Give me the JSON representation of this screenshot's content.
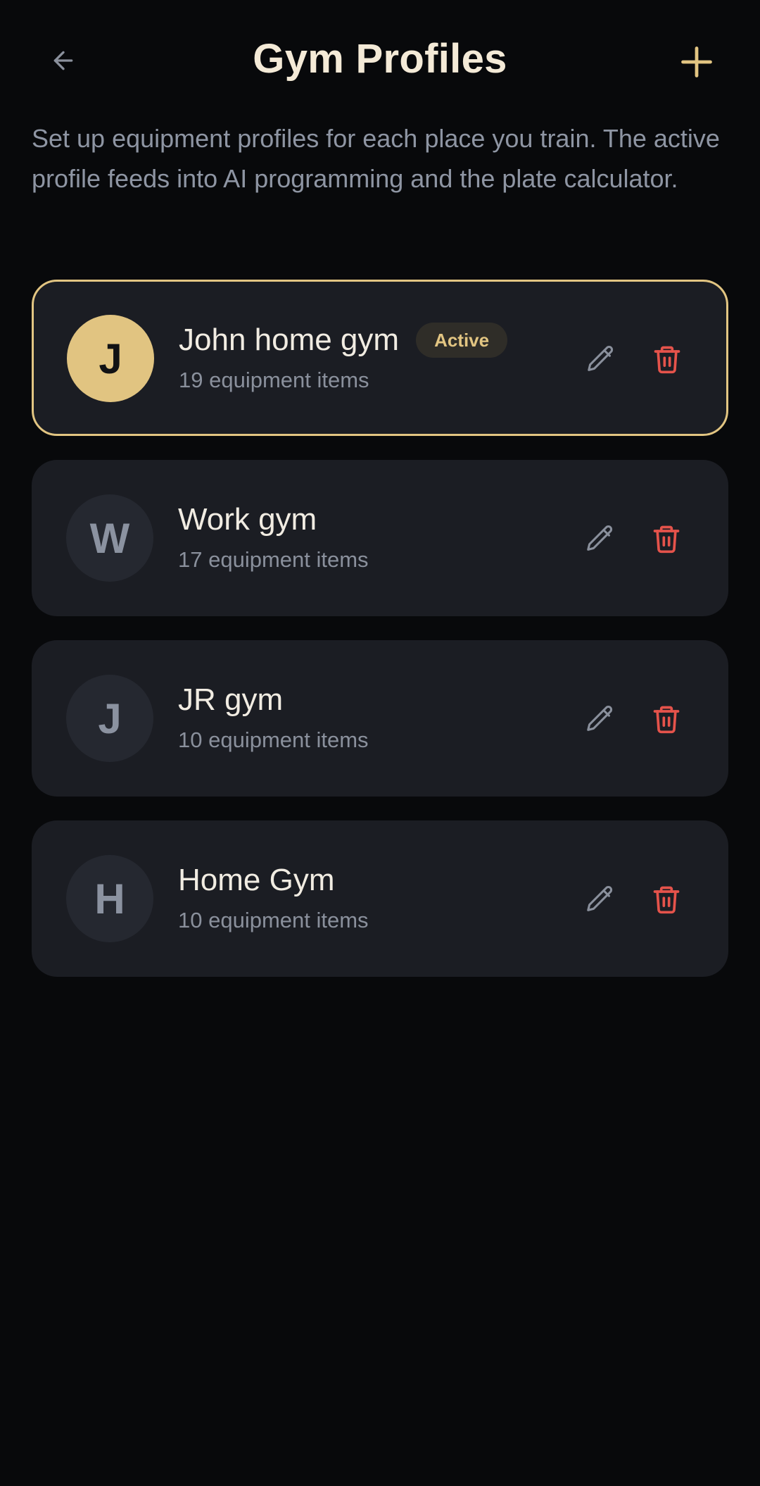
{
  "header": {
    "title": "Gym Profiles",
    "back_icon": "arrow-left-icon",
    "add_icon": "plus-icon"
  },
  "description": "Set up equipment profiles for each place you train. The active profile feeds into AI programming and the plate calculator.",
  "profiles": [
    {
      "initial": "J",
      "name": "John home gym",
      "badge": "Active",
      "items": "19 equipment items",
      "active": true
    },
    {
      "initial": "W",
      "name": "Work gym",
      "badge": "",
      "items": "17 equipment items",
      "active": false
    },
    {
      "initial": "J",
      "name": "JR gym",
      "badge": "",
      "items": "10 equipment items",
      "active": false
    },
    {
      "initial": "H",
      "name": "Home Gym",
      "badge": "",
      "items": "10 equipment items",
      "active": false
    }
  ],
  "colors": {
    "background": "#08090b",
    "card": "#1b1d23",
    "accent_gold": "#e2c582",
    "delete_red": "#e5534b",
    "muted_text": "#8e95a3"
  }
}
